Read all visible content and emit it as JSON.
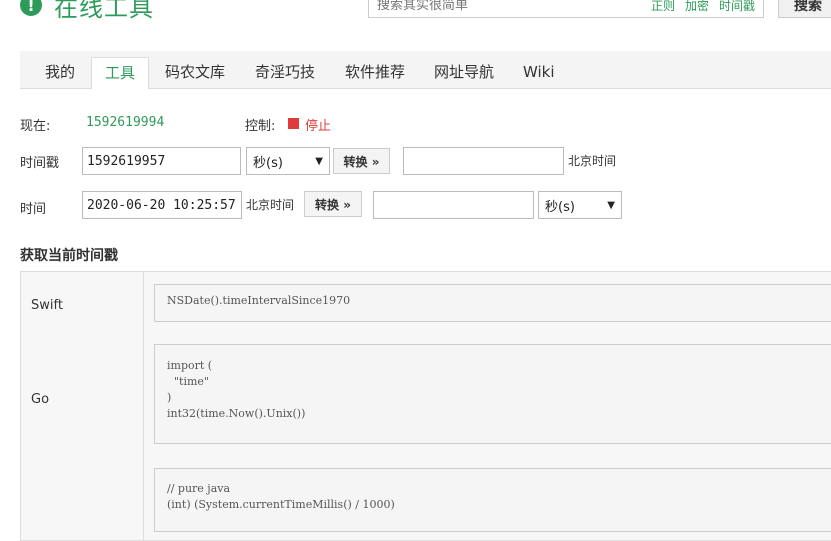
{
  "header": {
    "title": "在线工具",
    "logo_icon": "!",
    "search": {
      "placeholder": "搜索其实很简单",
      "tags": [
        "正则",
        "加密",
        "时间戳"
      ],
      "button": "搜索"
    }
  },
  "tabs": [
    {
      "label": "我的",
      "active": false
    },
    {
      "label": "工具",
      "active": true
    },
    {
      "label": "码农文库",
      "active": false
    },
    {
      "label": "奇淫巧技",
      "active": false
    },
    {
      "label": "软件推荐",
      "active": false
    },
    {
      "label": "网址导航",
      "active": false
    },
    {
      "label": "Wiki",
      "active": false
    }
  ],
  "now": {
    "label": "现在:",
    "value": "1592619994",
    "control_label": "控制:",
    "stop_label": "停止",
    "stop_color": "#e03c3c"
  },
  "timestamp_row": {
    "label": "时间戳",
    "value": "1592619957",
    "unit": "秒(s)",
    "convert_button": "转换 »",
    "result": "",
    "result_tz": "北京时间"
  },
  "time_row": {
    "label": "时间",
    "value": "2020-06-20 10:25:57",
    "tz": "北京时间",
    "convert_button": "转换 »",
    "result": "",
    "unit": "秒(s)"
  },
  "section": {
    "title": "获取当前时间戳"
  },
  "code_rows": [
    {
      "lang": "Swift",
      "code": "NSDate().timeIntervalSince1970"
    },
    {
      "lang": "Go",
      "code": "import (\n  \"time\"\n)\nint32(time.Now().Unix())"
    },
    {
      "lang": "",
      "code": "// pure java\n(int) (System.currentTimeMillis() / 1000)"
    }
  ],
  "colors": {
    "accent": "#2e9b5b",
    "stop": "#e03c3c"
  }
}
